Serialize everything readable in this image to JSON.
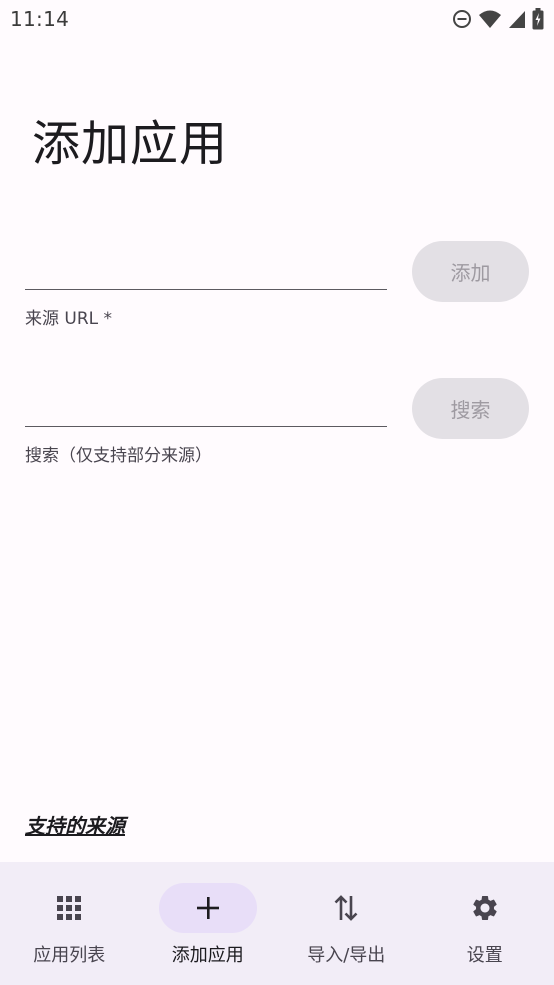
{
  "status_bar": {
    "time": "11:14",
    "icons": [
      "do-not-disturb-icon",
      "wifi-icon",
      "cell-signal-icon",
      "battery-charging-icon"
    ]
  },
  "page": {
    "title": "添加应用"
  },
  "url_field": {
    "value": "",
    "label": "来源 URL *",
    "button_label": "添加"
  },
  "search_field": {
    "value": "",
    "label": "搜索（仅支持部分来源）",
    "button_label": "搜索"
  },
  "links": {
    "supported_sources": "支持的来源"
  },
  "bottom_nav": {
    "items": [
      {
        "label": "应用列表",
        "icon": "grid-icon",
        "active": false
      },
      {
        "label": "添加应用",
        "icon": "plus-icon",
        "active": true
      },
      {
        "label": "导入/导出",
        "icon": "swap-vertical-icon",
        "active": false
      },
      {
        "label": "设置",
        "icon": "gear-icon",
        "active": false
      }
    ]
  },
  "colors": {
    "background": "#fffbfe",
    "nav_background": "#f2edf7",
    "active_pill": "#e8def8",
    "disabled_button": "#e3e0e5"
  }
}
